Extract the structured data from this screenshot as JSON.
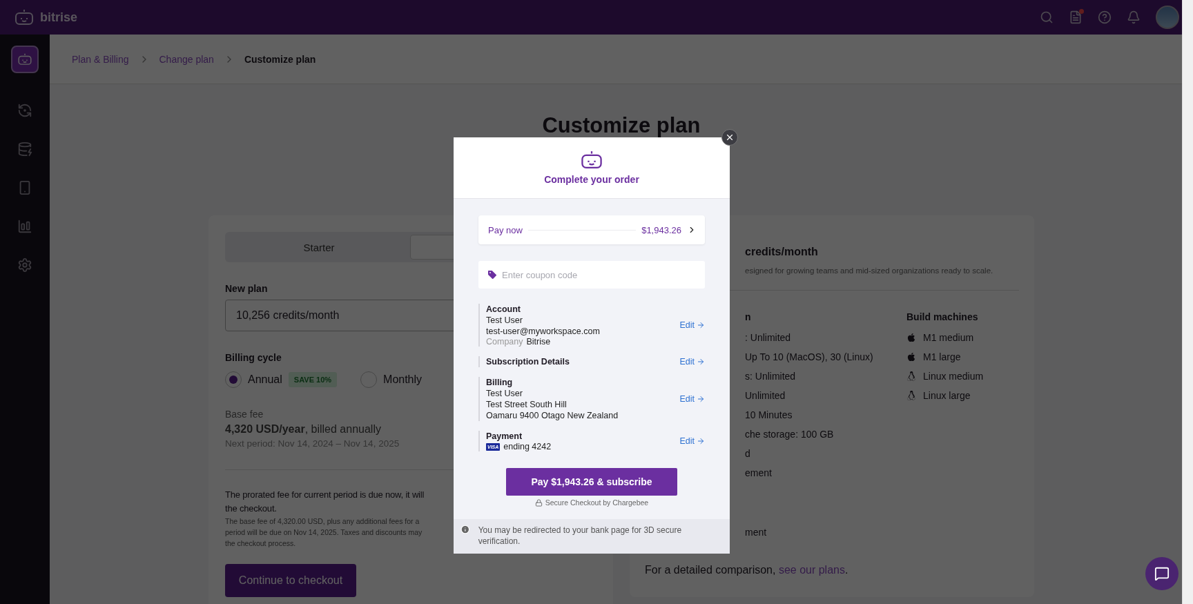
{
  "topbar": {
    "brand": "bitrise",
    "notification_dot": true
  },
  "breadcrumbs": [
    {
      "label": "Plan & Billing",
      "current": false
    },
    {
      "label": "Change plan",
      "current": false
    },
    {
      "label": "Customize plan",
      "current": true
    }
  ],
  "page_title": "Customize plan",
  "plan_tabs": [
    {
      "label": "Starter",
      "selected": false
    },
    {
      "selected": true
    }
  ],
  "new_plan": {
    "label": "New plan",
    "value": "10,256 credits/month"
  },
  "billing_cycle": {
    "label": "Billing cycle",
    "options": [
      {
        "label": "Annual",
        "badge": "SAVE 10%",
        "selected": true
      },
      {
        "label": "Monthly",
        "selected": false
      }
    ]
  },
  "base_fee": {
    "label": "Base fee",
    "amount": "**4,320 USD/year**, billed annually",
    "period": "Next period: Nov 14, 2024 – Nov 14, 2025"
  },
  "prorated_note": [
    "The prorated fee for current period is due now, it will",
    "the checkout."
  ],
  "fine_print": [
    "The base fee of 4,320.00 USD, plus any additional fees for a",
    "period will be due on Nov 14, 2025. Taxes and discounts may",
    "the checkout process."
  ],
  "continue_button": "Continue to checkout",
  "plan_summary": {
    "title": "credits/month",
    "description": "esigned for growing teams and mid-sized organizations ready to scale.",
    "features_heading": "n",
    "features": [
      ": Unlimited",
      "Up To 10 (MacOS), 30 (Linux)",
      "s: Unlimited",
      "Unlimited",
      "10 Minutes",
      "che storage: 100 GB",
      "d",
      "ement"
    ],
    "more_features": [
      "ment"
    ],
    "build_machines": {
      "heading": "Build machines",
      "items": [
        {
          "name": "M1 medium",
          "kind": "apple"
        },
        {
          "name": "M1 large",
          "kind": "apple"
        },
        {
          "name": "Linux medium",
          "kind": "linux"
        },
        {
          "name": "Linux large",
          "kind": "linux"
        }
      ]
    },
    "comparison": {
      "text": "For a detailed comparison,",
      "link": "see our plans",
      "end": "."
    }
  },
  "checkout_modal": {
    "title": "Complete your order",
    "pay_now": {
      "label": "Pay now",
      "amount": "$1,943.26"
    },
    "coupon": {
      "placeholder": "Enter coupon code"
    },
    "sections": [
      {
        "heading": "Account",
        "lines": [
          "Test User",
          "test-user@myworkspace.com"
        ],
        "fields": [
          {
            "label": "Company",
            "value": "Bitrise"
          }
        ],
        "action": "Edit"
      },
      {
        "heading": "Subscription Details",
        "action": "Edit"
      },
      {
        "heading": "Billing",
        "lines": [
          "Test User",
          "Test Street South Hill",
          "Oamaru 9400 Otago New Zealand"
        ],
        "action": "Edit"
      },
      {
        "heading": "Payment",
        "card": {
          "brand": "VISA",
          "ending": "ending 4242"
        },
        "action": "Edit"
      }
    ],
    "pay_button": "Pay $1,943.26 & subscribe",
    "secure_note": "Secure Checkout by Chargebee",
    "footer_note": "You may be redirected to your bank page for 3D secure verification."
  }
}
